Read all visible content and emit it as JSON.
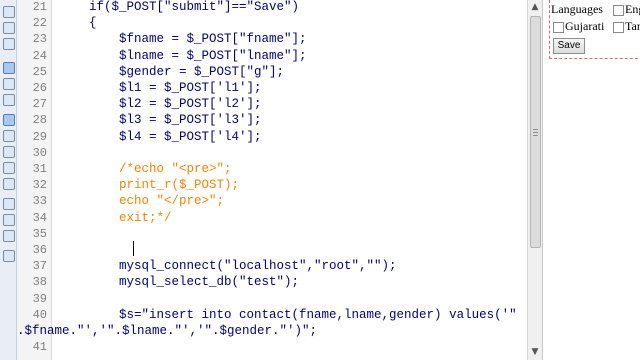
{
  "editor": {
    "lines": [
      {
        "num": "21",
        "text": "    if($_POST[\"submit\"]==\"Save\")",
        "kind": "code"
      },
      {
        "num": "22",
        "text": "    {",
        "kind": "code"
      },
      {
        "num": "23",
        "text": "        $fname = $_POST[\"fname\"];",
        "kind": "code"
      },
      {
        "num": "24",
        "text": "        $lname = $_POST[\"lname\"];",
        "kind": "code"
      },
      {
        "num": "25",
        "text": "        $gender = $_POST[\"g\"];",
        "kind": "code"
      },
      {
        "num": "26",
        "text": "        $l1 = $_POST['l1'];",
        "kind": "code"
      },
      {
        "num": "27",
        "text": "        $l2 = $_POST['l2'];",
        "kind": "code"
      },
      {
        "num": "28",
        "text": "        $l3 = $_POST['l3'];",
        "kind": "code"
      },
      {
        "num": "29",
        "text": "        $l4 = $_POST['l4'];",
        "kind": "code"
      },
      {
        "num": "30",
        "text": "",
        "kind": "code"
      },
      {
        "num": "31",
        "text": "        /*echo \"<pre>\";",
        "kind": "comment"
      },
      {
        "num": "32",
        "text": "        print_r($_POST);",
        "kind": "comment"
      },
      {
        "num": "33",
        "text": "        echo \"</pre>\";",
        "kind": "comment"
      },
      {
        "num": "34",
        "text": "        exit;*/",
        "kind": "comment"
      },
      {
        "num": "35",
        "text": "",
        "kind": "code"
      },
      {
        "num": "36",
        "text": "",
        "kind": "code"
      },
      {
        "num": "37",
        "text": "        mysql_connect(\"localhost\",\"root\",\"\");",
        "kind": "code"
      },
      {
        "num": "38",
        "text": "        mysql_select_db(\"test\");",
        "kind": "code"
      },
      {
        "num": "39",
        "text": "",
        "kind": "code"
      },
      {
        "num": "40",
        "text": "        $s=\"insert into contact(fname,lname,gender) values('\"",
        "kind": "code"
      },
      {
        "num": "",
        "text": ".$fname.\"','\".$lname.\"','\".$gender.\"')\";",
        "kind": "wrap"
      },
      {
        "num": "41",
        "text": "",
        "kind": "code"
      }
    ]
  },
  "preview": {
    "languages_label": "Languages",
    "eng_label": "Eng",
    "gujarati_label": "Gujarati",
    "tamil_label": "Tan",
    "save_label": "Save"
  }
}
